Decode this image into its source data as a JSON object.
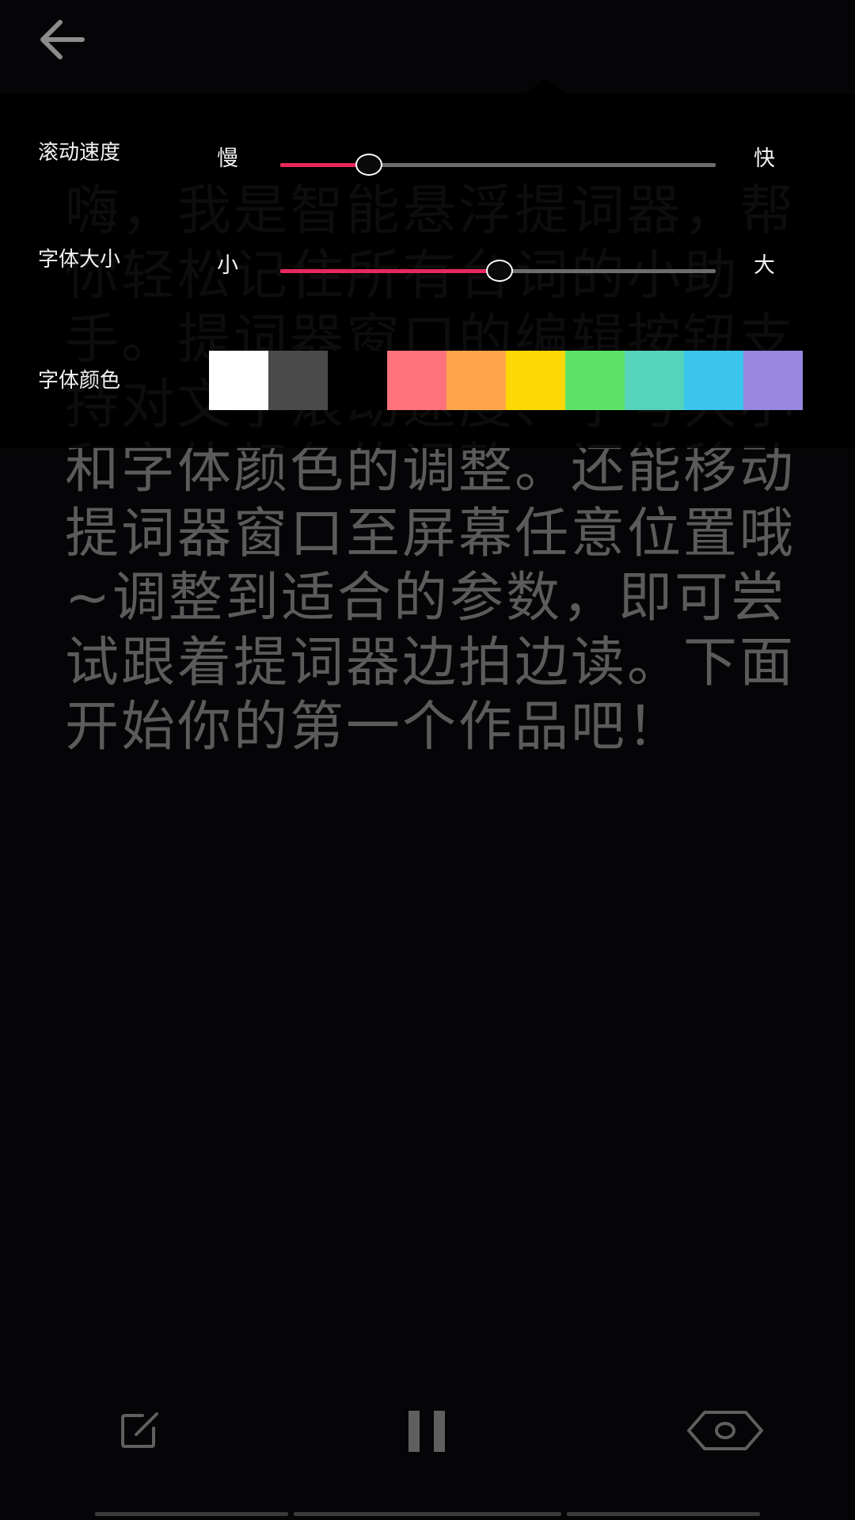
{
  "teleprompter": {
    "text": "嗨，我是智能悬浮提词器，帮你轻松记住所有台词的小助手。提词器窗口的编辑按钮支持对文字滚动速度、字号大小和字体颜色的调整。还能移动提词器窗口至屏幕任意位置哦~调整到适合的参数，即可尝试跟着提词器边拍边读。下面开始你的第一个作品吧！"
  },
  "settings": {
    "scroll_speed": {
      "label": "滚动速度",
      "min_label": "慢",
      "max_label": "快",
      "value": 0.2
    },
    "font_size": {
      "label": "字体大小",
      "min_label": "小",
      "max_label": "大",
      "value": 0.5
    },
    "font_color": {
      "label": "字体颜色",
      "swatches": [
        "#ffffff",
        "#4a4a4a",
        "#000000",
        "#fe737b",
        "#fea54b",
        "#fed804",
        "#5ce266",
        "#55d4bb",
        "#3ac4ee",
        "#9886e0"
      ]
    }
  },
  "icons": {
    "back": "arrow-left-icon",
    "edit": "edit-icon",
    "pause": "pause-icon",
    "preview": "eye-icon"
  },
  "colors": {
    "accent": "#e8285c",
    "text_dim": "#5b5b5c",
    "panel_bg": "#000000"
  }
}
